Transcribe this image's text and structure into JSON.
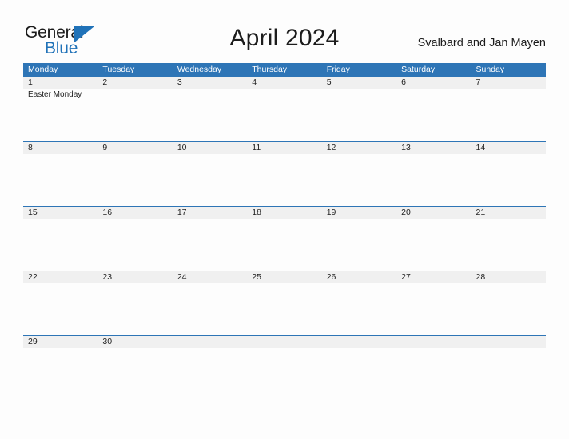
{
  "brand": {
    "name_part1": "General",
    "name_part2": "Blue",
    "triangle_icon": "triangle-icon",
    "accent_color": "#2072b8"
  },
  "header": {
    "title": "April 2024",
    "region": "Svalbard and Jan Mayen"
  },
  "calendar": {
    "header_bg_color": "#2e75b6",
    "date_band_color": "#f0f0f0",
    "weekdays": [
      "Monday",
      "Tuesday",
      "Wednesday",
      "Thursday",
      "Friday",
      "Saturday",
      "Sunday"
    ],
    "weeks": [
      [
        {
          "day": "1",
          "events": [
            "Easter Monday"
          ]
        },
        {
          "day": "2",
          "events": []
        },
        {
          "day": "3",
          "events": []
        },
        {
          "day": "4",
          "events": []
        },
        {
          "day": "5",
          "events": []
        },
        {
          "day": "6",
          "events": []
        },
        {
          "day": "7",
          "events": []
        }
      ],
      [
        {
          "day": "8",
          "events": []
        },
        {
          "day": "9",
          "events": []
        },
        {
          "day": "10",
          "events": []
        },
        {
          "day": "11",
          "events": []
        },
        {
          "day": "12",
          "events": []
        },
        {
          "day": "13",
          "events": []
        },
        {
          "day": "14",
          "events": []
        }
      ],
      [
        {
          "day": "15",
          "events": []
        },
        {
          "day": "16",
          "events": []
        },
        {
          "day": "17",
          "events": []
        },
        {
          "day": "18",
          "events": []
        },
        {
          "day": "19",
          "events": []
        },
        {
          "day": "20",
          "events": []
        },
        {
          "day": "21",
          "events": []
        }
      ],
      [
        {
          "day": "22",
          "events": []
        },
        {
          "day": "23",
          "events": []
        },
        {
          "day": "24",
          "events": []
        },
        {
          "day": "25",
          "events": []
        },
        {
          "day": "26",
          "events": []
        },
        {
          "day": "27",
          "events": []
        },
        {
          "day": "28",
          "events": []
        }
      ],
      [
        {
          "day": "29",
          "events": []
        },
        {
          "day": "30",
          "events": []
        },
        {
          "day": "",
          "events": []
        },
        {
          "day": "",
          "events": []
        },
        {
          "day": "",
          "events": []
        },
        {
          "day": "",
          "events": []
        },
        {
          "day": "",
          "events": []
        }
      ]
    ]
  }
}
